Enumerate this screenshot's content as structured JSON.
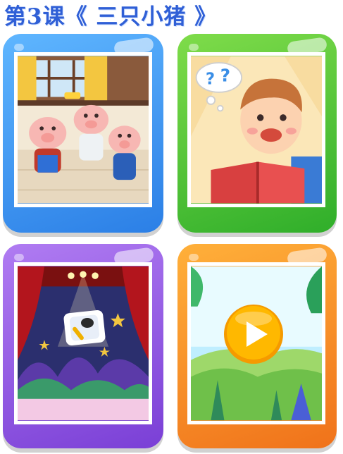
{
  "header": {
    "title": "第3课《 三只小猪 》"
  },
  "cards": [
    {
      "name": "story-pigs",
      "icon": "three-pigs-illustration",
      "color": "#3d96f2"
    },
    {
      "name": "reading-boy",
      "icon": "boy-reading-book-illustration",
      "color": "#47c032"
    },
    {
      "name": "stage-microphone",
      "icon": "microphone-stage-icon",
      "color": "#9257e6"
    },
    {
      "name": "play-video",
      "icon": "play-icon",
      "color": "#f38a24"
    }
  ],
  "colors": {
    "title": "#2f5fd6",
    "play_button": "#ffb800"
  }
}
